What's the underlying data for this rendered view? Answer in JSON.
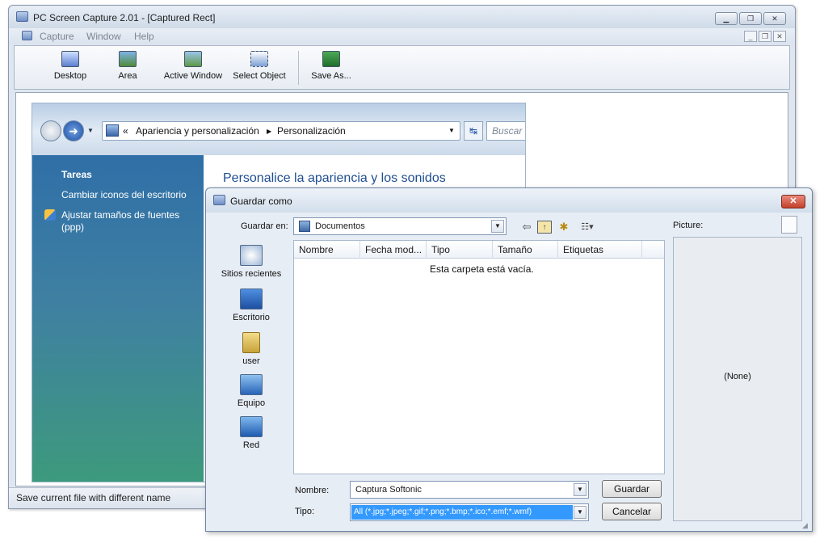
{
  "app": {
    "title": "PC Screen Capture 2.01 - [Captured Rect]",
    "menu": [
      "Capture",
      "Window",
      "Help"
    ],
    "toolbar": [
      {
        "label": "Desktop",
        "icon": "desktop-capture-icon"
      },
      {
        "label": "Area",
        "icon": "area-capture-icon"
      },
      {
        "label": "Active Window",
        "icon": "active-window-icon"
      },
      {
        "label": "Select Object",
        "icon": "select-object-icon"
      },
      {
        "label": "Save As...",
        "icon": "save-icon"
      }
    ],
    "window_buttons": {
      "minimize": "▁",
      "restore": "❐",
      "close": "✕"
    },
    "mdi_buttons": {
      "minimize": "_",
      "restore": "❐",
      "close": "✕"
    },
    "status": "Save current file with different name"
  },
  "captured": {
    "address_chevron": "«",
    "breadcrumb": [
      "Apariencia y personalización",
      "Personalización"
    ],
    "search_placeholder": "Buscar",
    "sidebar_heading": "Tareas",
    "sidebar_links": [
      "Cambiar iconos del escritorio",
      "Ajustar tamaños de fuentes",
      "(ppp)"
    ],
    "main_title": "Personalice la apariencia y los sonidos"
  },
  "dialog": {
    "title": "Guardar como",
    "close_glyph": "✕",
    "save_in_label": "Guardar en:",
    "save_in_value": "Documentos",
    "places": [
      {
        "label": "Sitios recientes",
        "icon": "recent-places-icon"
      },
      {
        "label": "Escritorio",
        "icon": "desktop-icon"
      },
      {
        "label": "user",
        "icon": "user-folder-icon"
      },
      {
        "label": "Equipo",
        "icon": "computer-icon"
      },
      {
        "label": "Red",
        "icon": "network-icon"
      }
    ],
    "columns": [
      "Nombre",
      "Fecha mod...",
      "Tipo",
      "Tamaño",
      "Etiquetas"
    ],
    "empty_message": "Esta carpeta está vacía.",
    "filename_label": "Nombre:",
    "filename_value": "Captura Softonic",
    "type_label": "Tipo:",
    "type_value": "All (*.jpg;*.jpeg;*.gif;*.png;*.bmp;*.ico;*.emf;*.wmf)",
    "save_button": "Guardar",
    "cancel_button": "Cancelar",
    "picture_label": "Picture:",
    "picture_value": "(None)"
  },
  "colors": {
    "accent_blue": "#1e4e92",
    "sidebar_top": "#2f6fa7",
    "sidebar_bottom": "#3d9a7c",
    "close_red": "#c3402b",
    "selection_blue": "#3399ff"
  }
}
